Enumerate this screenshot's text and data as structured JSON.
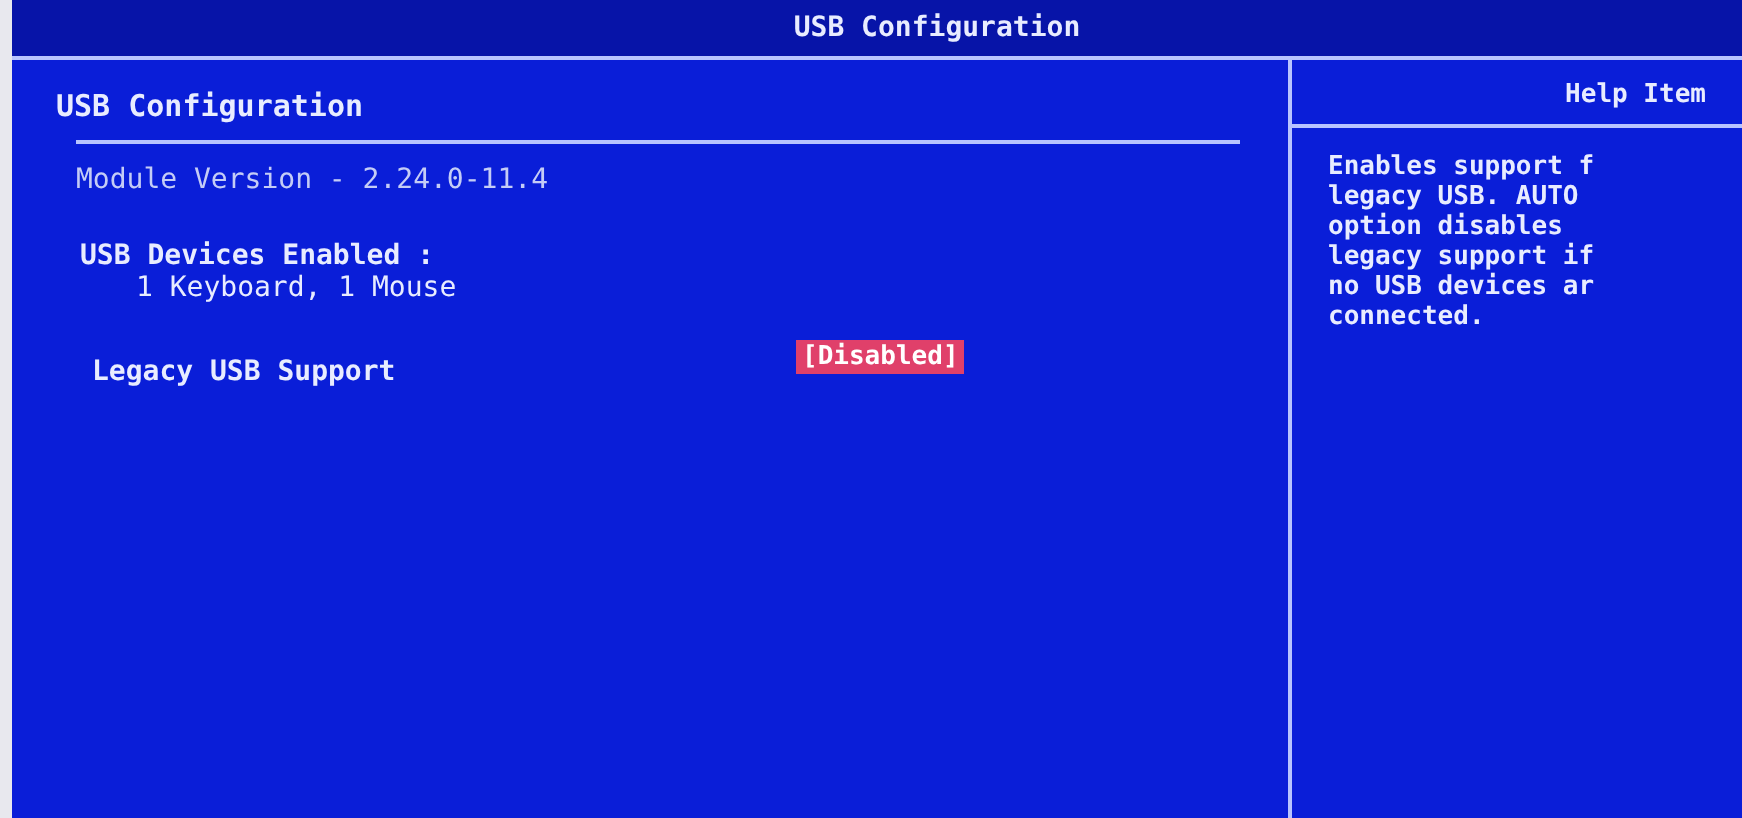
{
  "window": {
    "title": "USB Configuration"
  },
  "main": {
    "heading": "USB Configuration",
    "module_version": "Module Version - 2.24.0-11.4",
    "devices_label": "USB Devices Enabled :",
    "devices_value": "1 Keyboard, 1 Mouse",
    "settings": [
      {
        "label": "Legacy USB Support",
        "value": "[Disabled]",
        "selected": true
      }
    ]
  },
  "help": {
    "title": "Help Item",
    "lines": [
      "Enables support f",
      "legacy USB. AUTO",
      "option disables",
      "legacy support if",
      "no USB devices ar",
      "connected."
    ]
  }
}
